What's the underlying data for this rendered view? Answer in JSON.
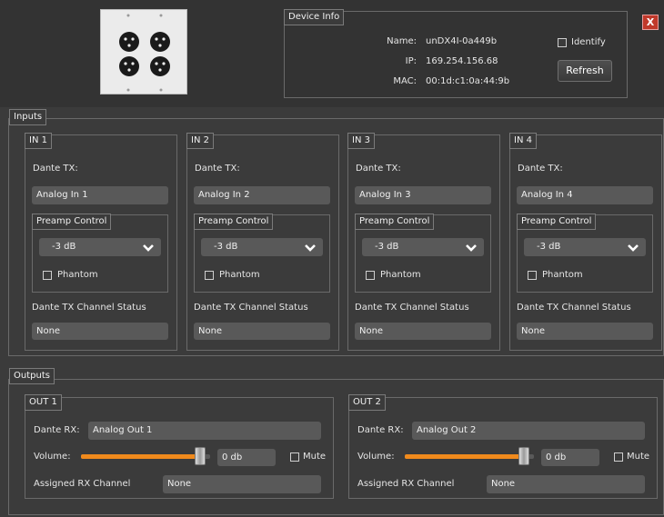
{
  "device_info": {
    "title": "Device Info",
    "name_label": "Name:",
    "name_value": "unDX4I-0a449b",
    "ip_label": "IP:",
    "ip_value": "169.254.156.68",
    "mac_label": "MAC:",
    "mac_value": "00:1d:c1:0a:44:9b",
    "identify_label": "Identify",
    "refresh_label": "Refresh",
    "close_label": "X"
  },
  "inputs": {
    "title": "Inputs",
    "channels": [
      {
        "title": "IN 1",
        "dante_tx_label": "Dante TX:",
        "dante_tx_value": "Analog In 1",
        "preamp_title": "Preamp Control",
        "preamp_value": "-3 dB",
        "phantom_label": "Phantom",
        "status_label": "Dante TX Channel Status",
        "status_value": "None"
      },
      {
        "title": "IN 2",
        "dante_tx_label": "Dante TX:",
        "dante_tx_value": "Analog In 2",
        "preamp_title": "Preamp Control",
        "preamp_value": "-3 dB",
        "phantom_label": "Phantom",
        "status_label": "Dante TX Channel Status",
        "status_value": "None"
      },
      {
        "title": "IN 3",
        "dante_tx_label": "Dante TX:",
        "dante_tx_value": "Analog In 3",
        "preamp_title": "Preamp Control",
        "preamp_value": "-3 dB",
        "phantom_label": "Phantom",
        "status_label": "Dante TX Channel Status",
        "status_value": "None"
      },
      {
        "title": "IN 4",
        "dante_tx_label": "Dante TX:",
        "dante_tx_value": "Analog In 4",
        "preamp_title": "Preamp Control",
        "preamp_value": "-3 dB",
        "phantom_label": "Phantom",
        "status_label": "Dante TX Channel Status",
        "status_value": "None"
      }
    ]
  },
  "outputs": {
    "title": "Outputs",
    "channels": [
      {
        "title": "OUT 1",
        "dante_rx_label": "Dante RX:",
        "dante_rx_value": "Analog Out 1",
        "volume_label": "Volume:",
        "volume_value": "0 db",
        "volume_fraction": 0.92,
        "mute_label": "Mute",
        "assigned_label": "Assigned RX Channel",
        "assigned_value": "None"
      },
      {
        "title": "OUT 2",
        "dante_rx_label": "Dante RX:",
        "dante_rx_value": "Analog Out 2",
        "volume_label": "Volume:",
        "volume_value": "0 db",
        "volume_fraction": 0.92,
        "mute_label": "Mute",
        "assigned_label": "Assigned RX Channel",
        "assigned_value": "None"
      }
    ]
  },
  "colors": {
    "background": "#3b3b3b",
    "field": "#595959",
    "slider_fill": "#f08a1c",
    "close_button": "#c0392b"
  }
}
